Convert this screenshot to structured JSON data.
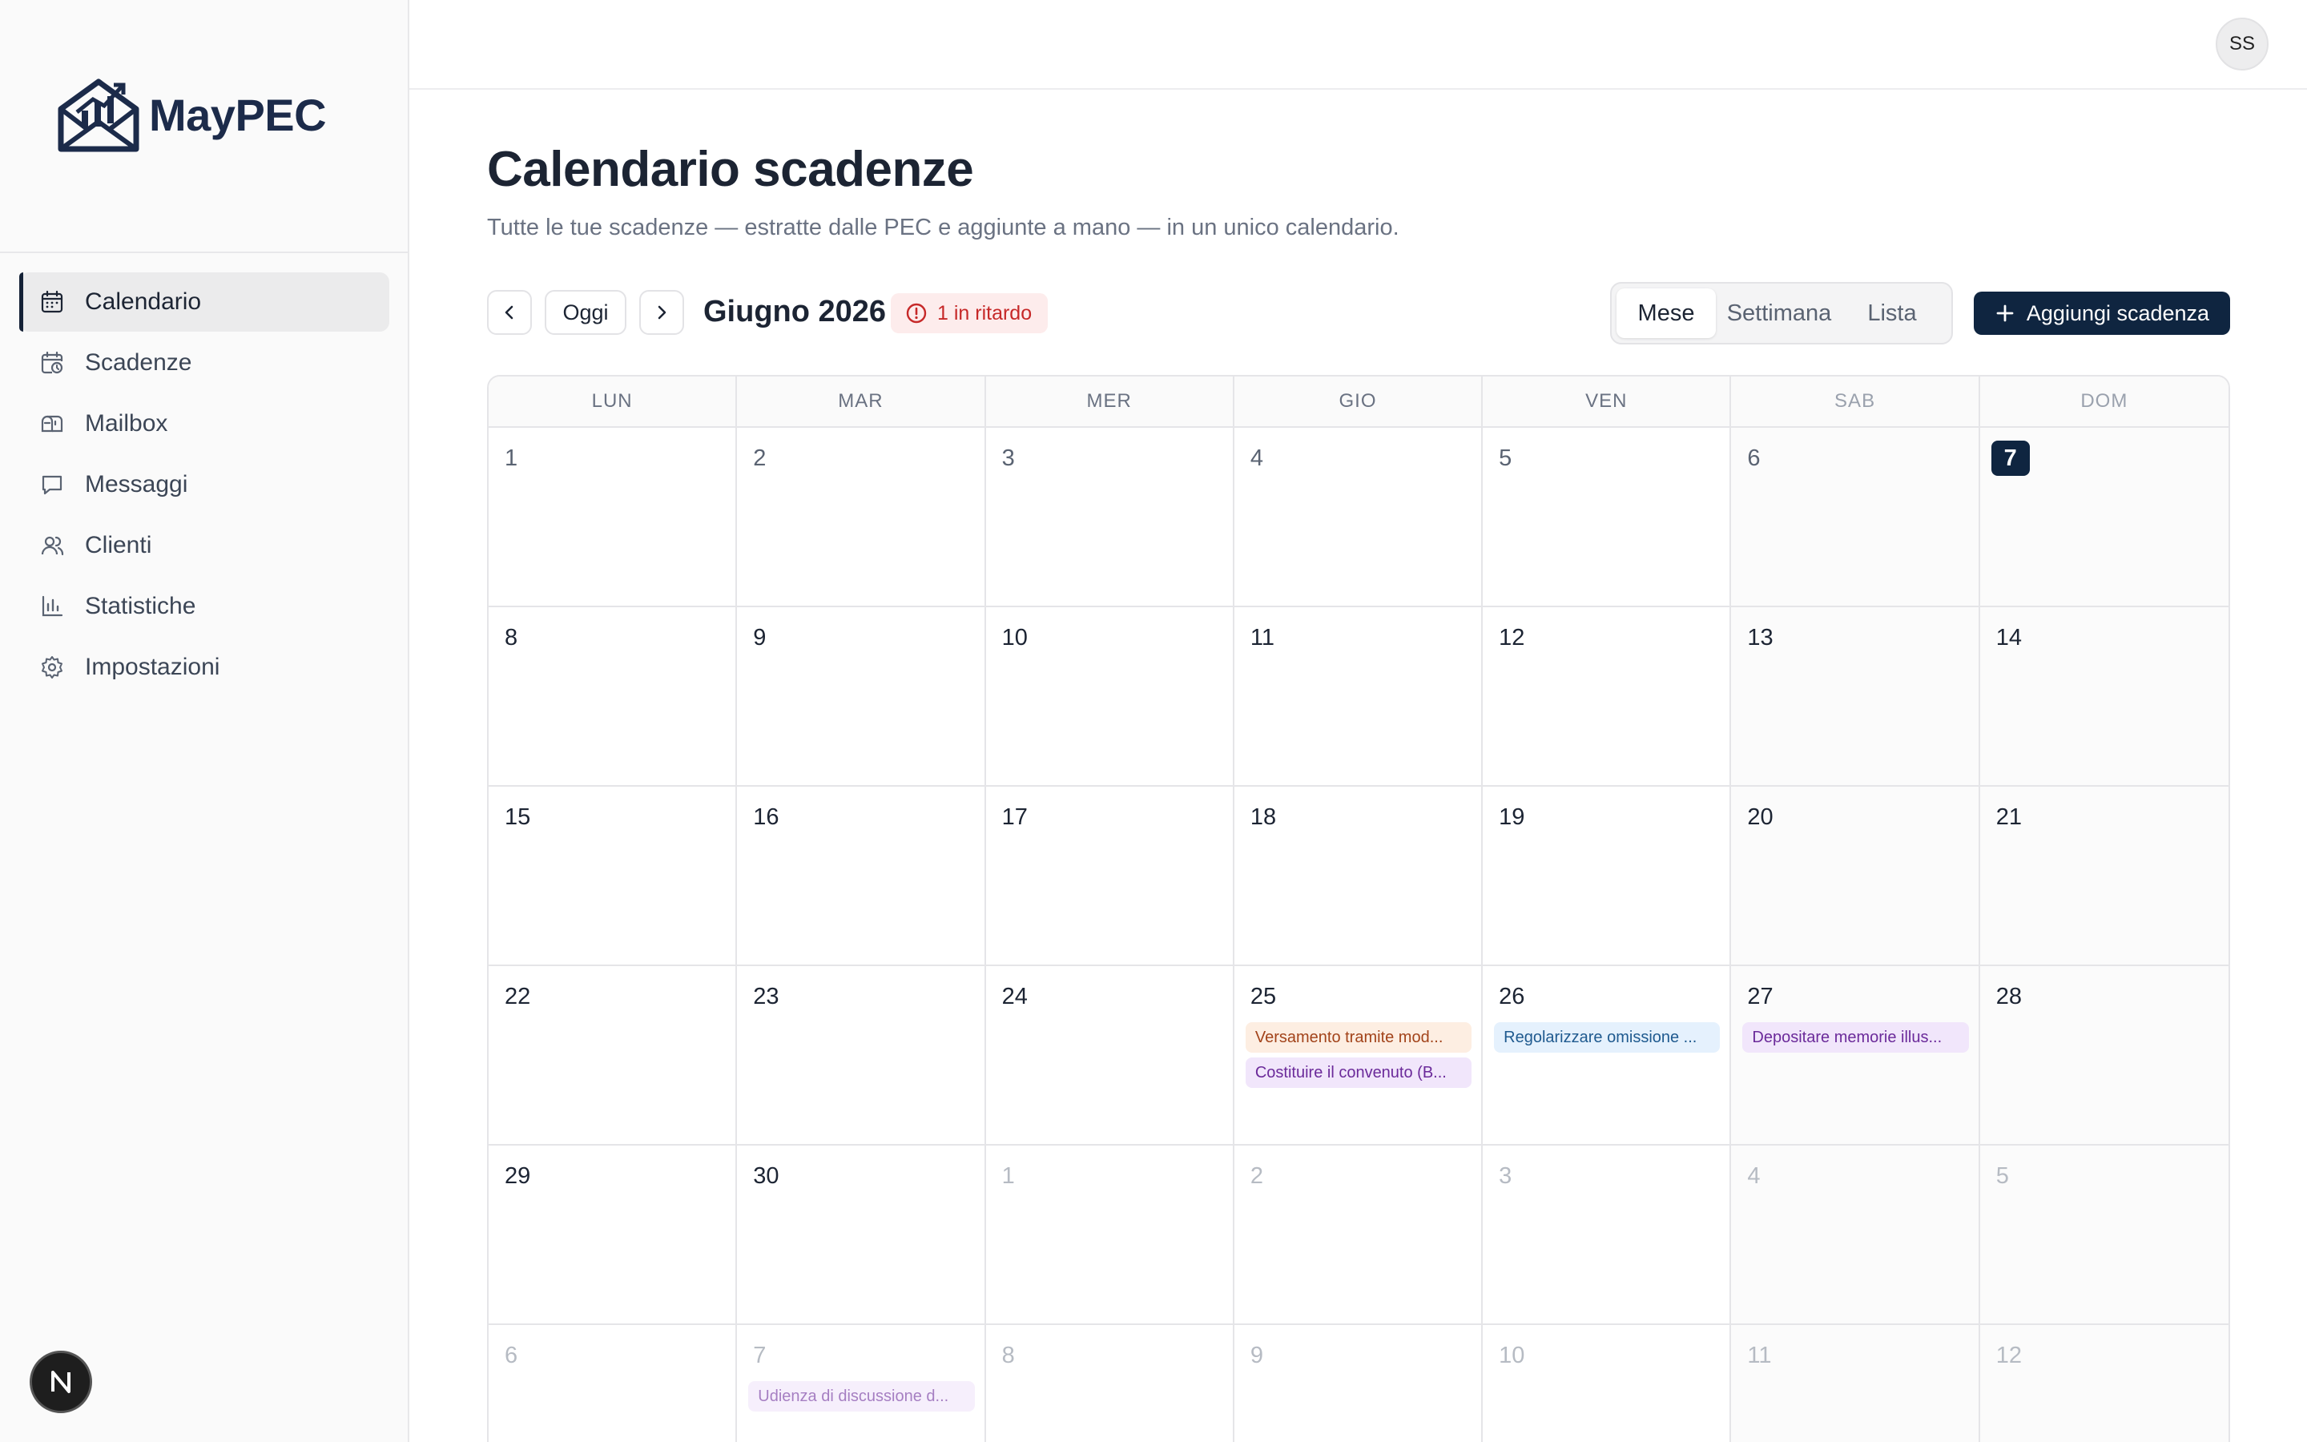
{
  "brand": {
    "name": "MayPEC"
  },
  "sidebar": {
    "items": [
      {
        "label": "Calendario",
        "icon": "calendar-icon",
        "active": true
      },
      {
        "label": "Scadenze",
        "icon": "calendar-clock-icon",
        "active": false
      },
      {
        "label": "Mailbox",
        "icon": "mailbox-icon",
        "active": false
      },
      {
        "label": "Messaggi",
        "icon": "message-icon",
        "active": false
      },
      {
        "label": "Clienti",
        "icon": "users-icon",
        "active": false
      },
      {
        "label": "Statistiche",
        "icon": "bar-chart-icon",
        "active": false
      },
      {
        "label": "Impostazioni",
        "icon": "gear-icon",
        "active": false
      }
    ]
  },
  "header": {
    "avatar_initials": "SS"
  },
  "page": {
    "title": "Calendario scadenze",
    "subtitle": "Tutte le tue scadenze — estratte dalle PEC e aggiunte a mano — in un unico calendario."
  },
  "toolbar": {
    "today_label": "Oggi",
    "month_label": "Giugno 2026",
    "late_badge": "1 in ritardo",
    "views": [
      "Mese",
      "Settimana",
      "Lista"
    ],
    "active_view": "Mese",
    "add_label": "Aggiungi scadenza"
  },
  "calendar": {
    "weekdays": [
      "LUN",
      "MAR",
      "MER",
      "GIO",
      "VEN",
      "SAB",
      "DOM"
    ],
    "weeks": [
      [
        {
          "day": "1"
        },
        {
          "day": "2"
        },
        {
          "day": "3"
        },
        {
          "day": "4"
        },
        {
          "day": "5"
        },
        {
          "day": "6"
        },
        {
          "day": "7",
          "today": true
        }
      ],
      [
        {
          "day": "8"
        },
        {
          "day": "9"
        },
        {
          "day": "10"
        },
        {
          "day": "11"
        },
        {
          "day": "12"
        },
        {
          "day": "13"
        },
        {
          "day": "14"
        }
      ],
      [
        {
          "day": "15"
        },
        {
          "day": "16"
        },
        {
          "day": "17"
        },
        {
          "day": "18"
        },
        {
          "day": "19"
        },
        {
          "day": "20"
        },
        {
          "day": "21"
        }
      ],
      [
        {
          "day": "22"
        },
        {
          "day": "23"
        },
        {
          "day": "24"
        },
        {
          "day": "25",
          "events": [
            {
              "title": "Versamento tramite mod...",
              "color": "orange"
            },
            {
              "title": "Costituire il convenuto (B...",
              "color": "purple"
            }
          ]
        },
        {
          "day": "26",
          "events": [
            {
              "title": "Regolarizzare omissione ...",
              "color": "blue"
            }
          ]
        },
        {
          "day": "27",
          "events": [
            {
              "title": "Depositare memorie illus...",
              "color": "purple"
            }
          ]
        },
        {
          "day": "28"
        }
      ],
      [
        {
          "day": "29"
        },
        {
          "day": "30"
        },
        {
          "day": "1",
          "other": true
        },
        {
          "day": "2",
          "other": true
        },
        {
          "day": "3",
          "other": true
        },
        {
          "day": "4",
          "other": true
        },
        {
          "day": "5",
          "other": true
        }
      ],
      [
        {
          "day": "6",
          "other": true
        },
        {
          "day": "7",
          "other": true,
          "events": [
            {
              "title": "Udienza di discussione d...",
              "color": "purple"
            }
          ]
        },
        {
          "day": "8",
          "other": true
        },
        {
          "day": "9",
          "other": true
        },
        {
          "day": "10",
          "other": true
        },
        {
          "day": "11",
          "other": true
        },
        {
          "day": "12",
          "other": true
        }
      ]
    ]
  }
}
